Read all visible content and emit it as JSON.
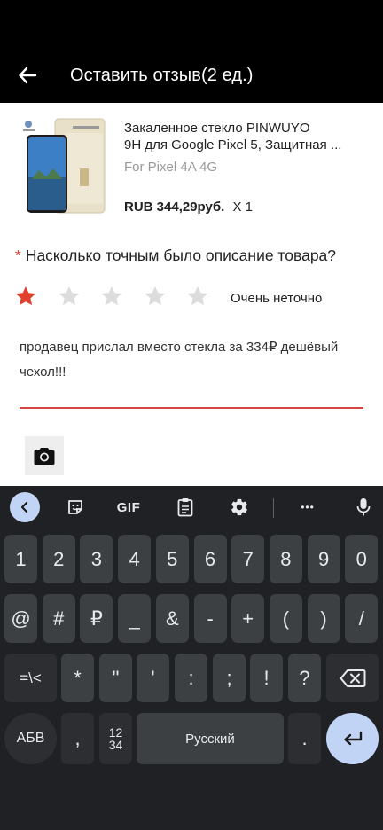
{
  "header": {
    "title": "Оставить отзыв(2 ед.)"
  },
  "product": {
    "title_line1": "Закаленное стекло PINWUYO",
    "title_line2": "9H для Google Pixel 5, Защитная ...",
    "variant": "For Pixel 4A 4G",
    "price": "RUB 344,29руб.",
    "quantity": "X 1"
  },
  "rating": {
    "required_mark": "*",
    "question": "Насколько точным было описание товара?",
    "value": 1,
    "max": 5,
    "label": "Очень неточно",
    "filled_color": "#e0412f",
    "empty_color": "#dcdcdc"
  },
  "review": {
    "text": "продавец прислал вместо стекла за 334₽ дешёвый чехол!!!"
  },
  "keyboard": {
    "toolbar": {
      "gif_label": "GIF",
      "more_label": "•••"
    },
    "row1": [
      "1",
      "2",
      "3",
      "4",
      "5",
      "6",
      "7",
      "8",
      "9",
      "0"
    ],
    "row2": [
      "@",
      "#",
      "₽",
      "_",
      "&",
      "-",
      "+",
      "(",
      ")",
      "/"
    ],
    "row3": [
      "=\\<",
      "*",
      "\"",
      "'",
      ":",
      ";",
      "!",
      "?"
    ],
    "abc_label": "АБВ",
    "comma_label": ",",
    "numbers_label_top": "12",
    "numbers_label_bottom": "34",
    "space_label": "Русский",
    "period_label": "."
  }
}
